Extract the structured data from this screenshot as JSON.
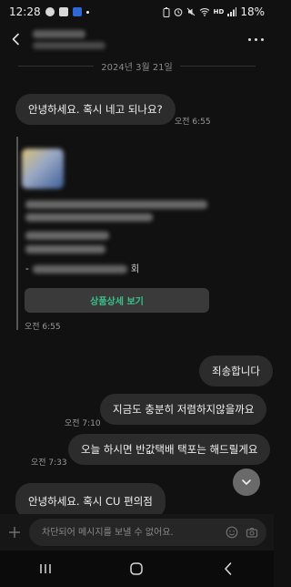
{
  "status": {
    "time": "12:28",
    "battery": "18%",
    "network_badge": "HD"
  },
  "header": {
    "contact_name": "",
    "contact_sub": ""
  },
  "date_separator": "2024년 3월 21일",
  "messages": [
    {
      "text": "안녕하세요.  혹시 네고 되나요?",
      "time": "오전 6:55"
    },
    {
      "text": "죄송합니다"
    },
    {
      "text": "지금도 충분히 저렴하지않을까요",
      "time": "오전 7:10"
    },
    {
      "text": "오늘 하시면 반값택배 택포는 해드릴게요",
      "time": "오전 7:33"
    },
    {
      "text": "안녕하세요.  혹시 CU 편의점"
    }
  ],
  "product_card": {
    "prefix": "-",
    "suffix": "회",
    "button_label": "상품상세 보기",
    "time": "오전 6:55"
  },
  "composer": {
    "placeholder": "차단되어 메시지를 보낼 수 없어요."
  }
}
